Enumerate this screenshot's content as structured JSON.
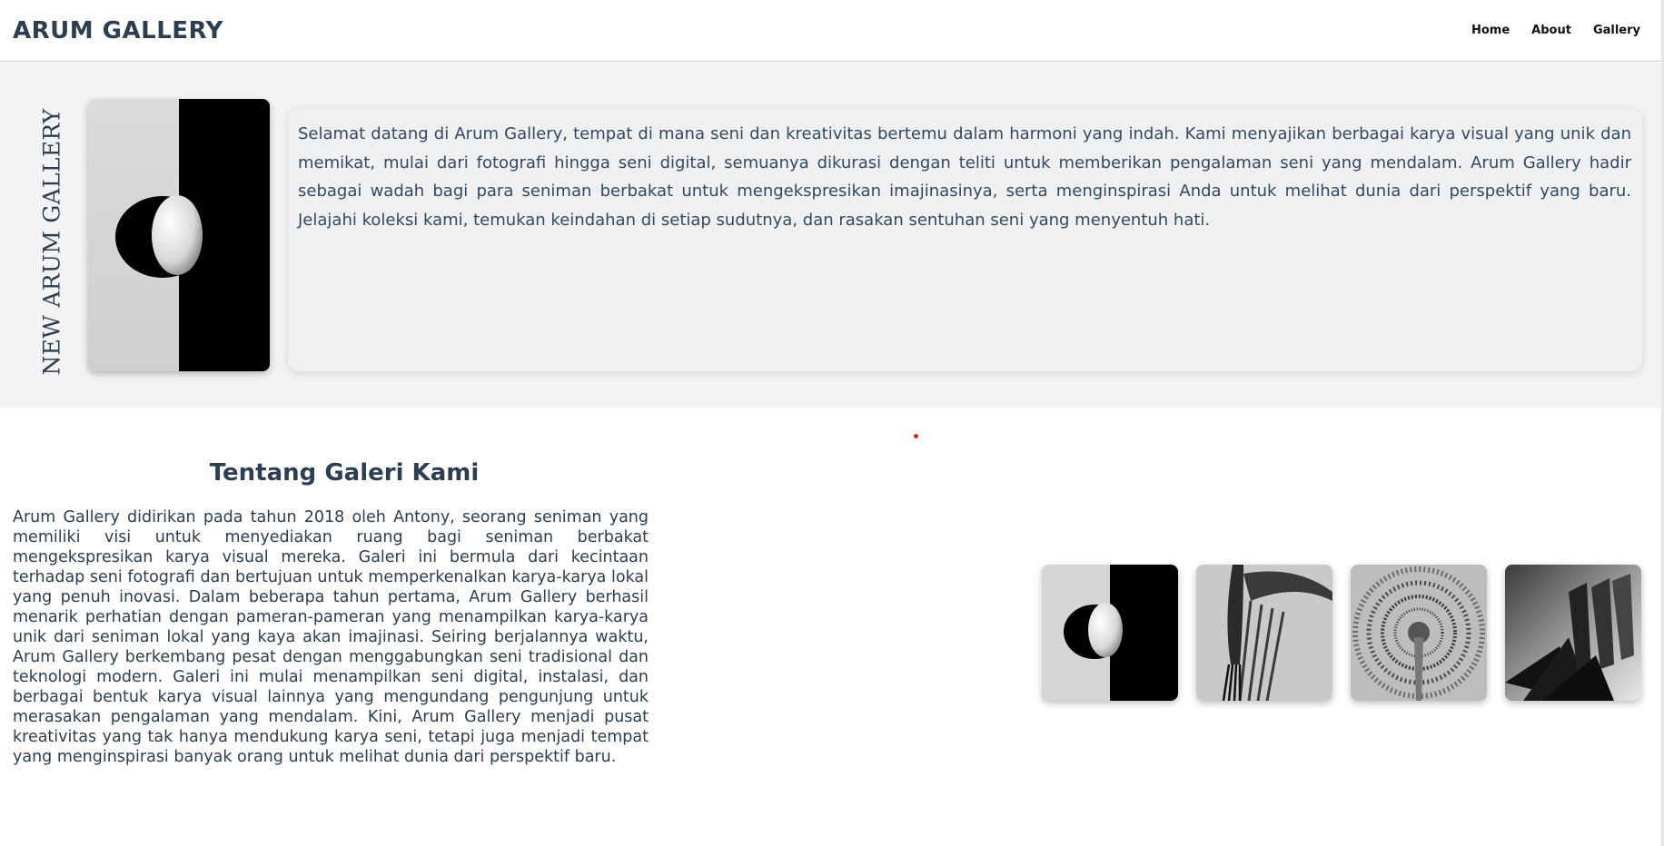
{
  "header": {
    "brand": "ARUM GALLERY",
    "nav": [
      {
        "label": "Home"
      },
      {
        "label": "About"
      },
      {
        "label": "Gallery"
      }
    ]
  },
  "hero": {
    "vertical_title": "NEW ARUM GALLERY",
    "image_icon": "egg-half-shadow-photo",
    "intro": "Selamat datang di Arum Gallery, tempat di mana seni dan kreativitas bertemu dalam harmoni yang indah. Kami menyajikan berbagai karya visual yang unik dan memikat, mulai dari fotografi hingga seni digital, semuanya dikurasi dengan teliti untuk memberikan pengalaman seni yang mendalam. Arum Gallery hadir sebagai wadah bagi para seniman berbakat untuk mengekspresikan imajinasinya, serta menginspirasi Anda untuk melihat dunia dari perspektif yang baru. Jelajahi koleksi kami, temukan keindahan di setiap sudutnya, dan rasakan sentuhan seni yang menyentuh hati."
  },
  "about": {
    "title": "Tentang Galeri Kami",
    "text": "Arum Gallery didirikan pada tahun 2018 oleh Antony, seorang seniman yang memiliki visi untuk menyediakan ruang bagi seniman berbakat mengekspresikan karya visual mereka. Galeri ini bermula dari kecintaan terhadap seni fotografi dan bertujuan untuk memperkenalkan karya-karya lokal yang penuh inovasi. Dalam beberapa tahun pertama, Arum Gallery berhasil menarik perhatian dengan pameran-pameran yang menampilkan karya-karya unik dari seniman lokal yang kaya akan imajinasi. Seiring berjalannya waktu, Arum Gallery berkembang pesat dengan menggabungkan seni tradisional dan teknologi modern. Galeri ini mulai menampilkan seni digital, instalasi, dan berbagai bentuk karya visual lainnya yang mengundang pengunjung untuk merasakan pengalaman yang mendalam. Kini, Arum Gallery menjadi pusat kreativitas yang tak hanya mendukung karya seni, tetapi juga menjadi tempat yang menginspirasi banyak orang untuk melihat dunia dari perspektif baru."
  },
  "gallery": {
    "thumbnails": [
      {
        "icon": "egg-photo"
      },
      {
        "icon": "fork-harp-shadow-photo"
      },
      {
        "icon": "book-tunnel-photo"
      },
      {
        "icon": "forks-shadow-photo"
      }
    ]
  },
  "colors": {
    "heading": "#2c3e50",
    "hero_bg": "#f2f3f4",
    "card_bg": "#eef0f2",
    "accent_dot": "#d62828"
  }
}
